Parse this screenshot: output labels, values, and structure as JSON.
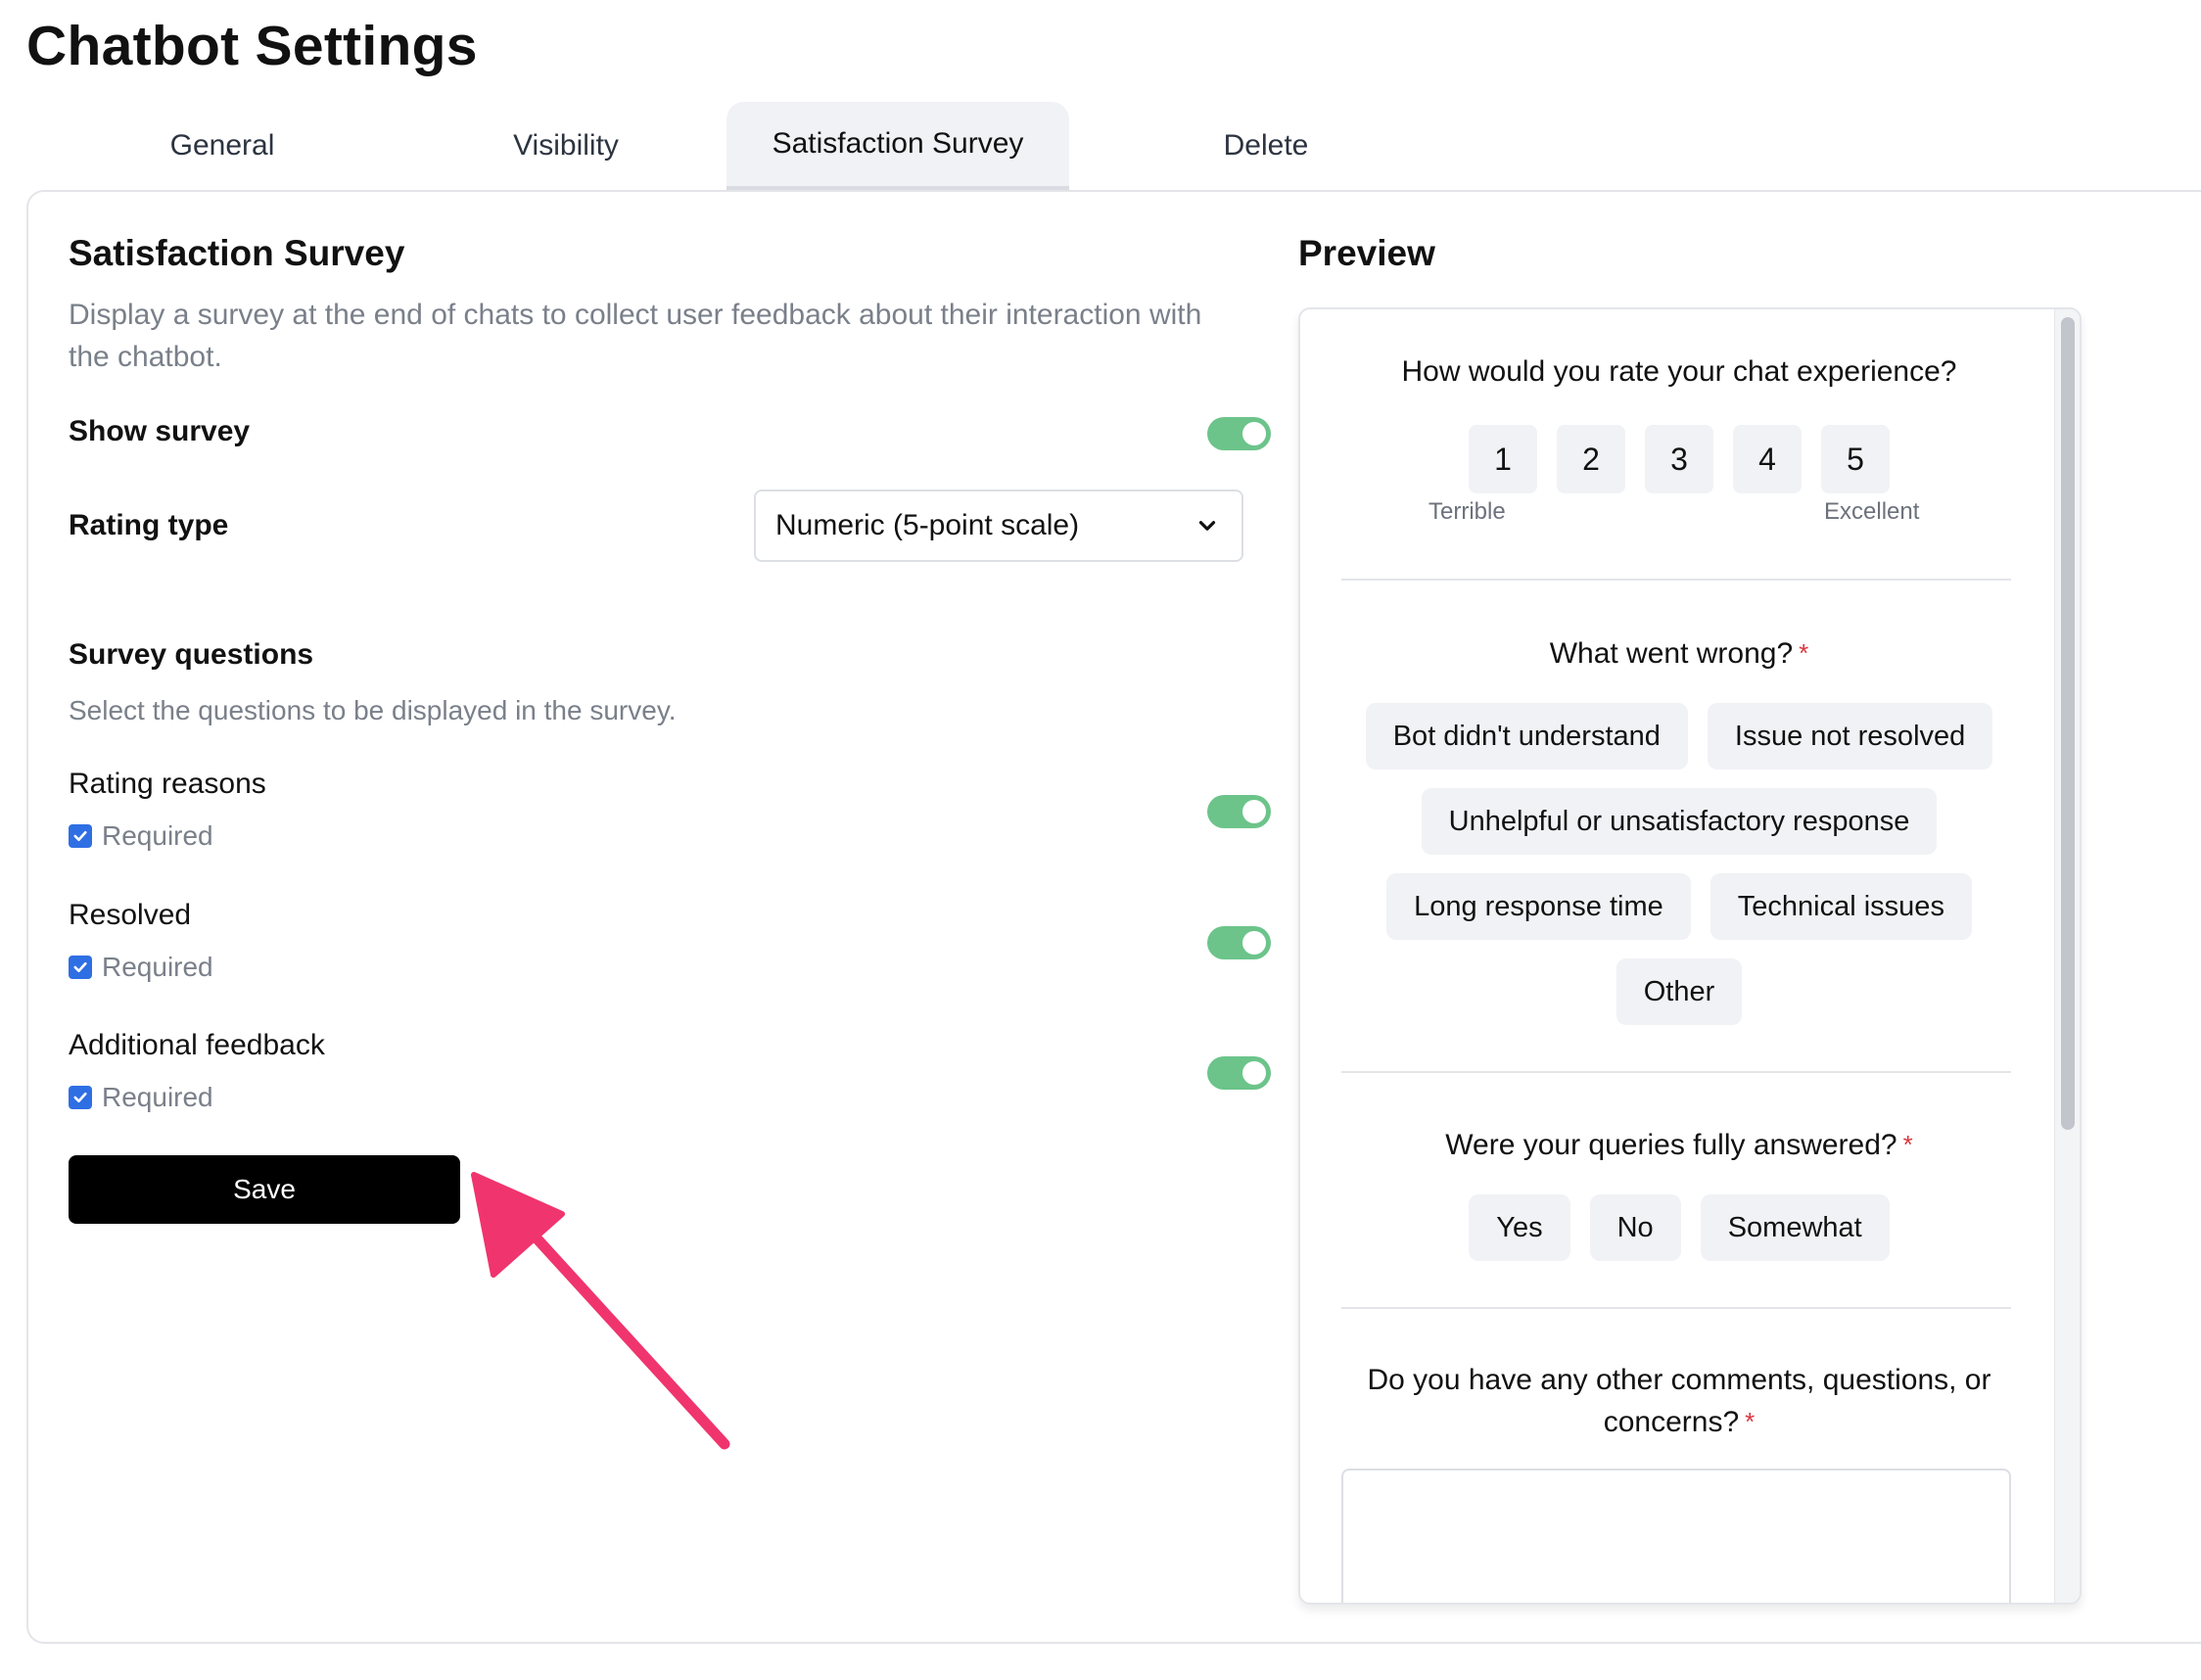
{
  "page": {
    "title": "Chatbot Settings"
  },
  "tabs": [
    {
      "label": "General"
    },
    {
      "label": "Visibility"
    },
    {
      "label": "Satisfaction Survey"
    },
    {
      "label": "Delete"
    }
  ],
  "active_tab": "Satisfaction Survey",
  "settings": {
    "title": "Satisfaction Survey",
    "description": "Display a survey at the end of chats to collect user feedback about their interaction with the chatbot.",
    "show_survey": {
      "label": "Show survey",
      "enabled": true
    },
    "rating_type": {
      "label": "Rating type",
      "value": "Numeric (5-point scale)"
    },
    "survey_questions": {
      "label": "Survey questions",
      "description": "Select the questions to be displayed in the survey.",
      "items": [
        {
          "label": "Rating reasons",
          "enabled": true,
          "required_label": "Required",
          "required": true
        },
        {
          "label": "Resolved",
          "enabled": true,
          "required_label": "Required",
          "required": true
        },
        {
          "label": "Additional feedback",
          "enabled": true,
          "required_label": "Required",
          "required": true
        }
      ]
    },
    "save_label": "Save"
  },
  "preview": {
    "title": "Preview",
    "rating_question": "How would you rate your chat experience?",
    "rating_options": [
      "1",
      "2",
      "3",
      "4",
      "5"
    ],
    "low_label": "Terrible",
    "high_label": "Excellent",
    "wrong_question": "What went wrong?",
    "wrong_options": [
      "Bot didn't understand",
      "Issue not resolved",
      "Unhelpful or unsatisfactory response",
      "Long response time",
      "Technical issues",
      "Other"
    ],
    "resolved_question": "Were your queries fully answered?",
    "resolved_options": [
      "Yes",
      "No",
      "Somewhat"
    ],
    "comments_question_line1": "Do you have any other comments, questions, or",
    "comments_question_line2": "concerns?",
    "required_marker": "*"
  },
  "colors": {
    "toggle_on": "#6cc48a",
    "checkbox": "#2f6fe4",
    "save_button": "#000000",
    "required_marker": "#d9363e",
    "annotation_arrow": "#f0346e"
  },
  "icons": {
    "select_chevron": "chevron-down-icon",
    "checkbox_check": "check-icon",
    "annotation": "arrow-annotation-icon"
  }
}
